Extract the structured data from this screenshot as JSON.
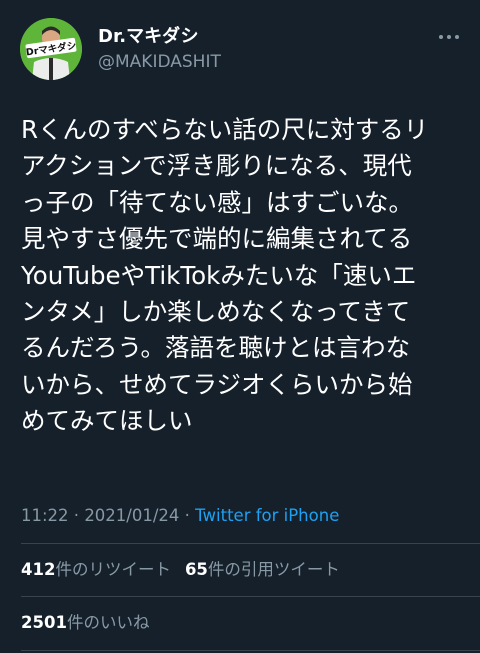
{
  "author": {
    "display_name": "Dr.マキダシ",
    "handle": "@MAKIDASHIT",
    "avatar_text": "Drマキダシ"
  },
  "tweet": {
    "text": "Rくんのすべらない話の尺に対するリ\nアクションで浮き彫りになる、現代\nっ子の「待てない感」はすごいな。\n見やすさ優先で端的に編集されてる\nYouTubeやTikTokみたいな「速いエ\nンタメ」しか楽しめなくなってきて\nるんだろう。落語を聴けとは言わな\nいから、せめてラジオくらいから始\nめてみてほしい"
  },
  "meta": {
    "time": "11:22",
    "separator1": " · ",
    "date": "2021/01/24",
    "separator2": " · ",
    "source": "Twitter for iPhone"
  },
  "stats": {
    "retweets_count": "412",
    "retweets_label": "件のリツイート",
    "quotes_count": "65",
    "quotes_label": "件の引用ツイート",
    "likes_count": "2501",
    "likes_label": "件のいいね"
  },
  "colors": {
    "background": "#15202b",
    "secondary_text": "#8899a6",
    "link": "#1da1f2",
    "divider": "#38444d"
  }
}
